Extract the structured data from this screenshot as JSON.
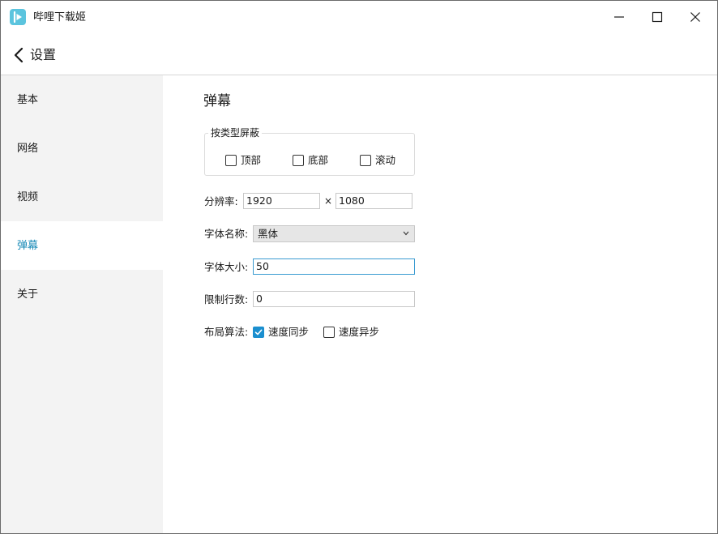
{
  "window": {
    "app_title": "哔哩下载姬",
    "icons": {
      "app": "app-logo-icon",
      "minimize": "minimize-icon",
      "maximize": "maximize-icon",
      "close": "close-icon"
    }
  },
  "header": {
    "back_icon": "chevron-left-icon",
    "title": "设置"
  },
  "sidebar": {
    "items": [
      {
        "label": "基本",
        "active": false
      },
      {
        "label": "网络",
        "active": false
      },
      {
        "label": "视频",
        "active": false
      },
      {
        "label": "弹幕",
        "active": true
      },
      {
        "label": "关于",
        "active": false
      }
    ]
  },
  "content": {
    "section_title": "弹幕",
    "block_by_type": {
      "legend": "按类型屏蔽",
      "options": [
        {
          "label": "顶部",
          "checked": false
        },
        {
          "label": "底部",
          "checked": false
        },
        {
          "label": "滚动",
          "checked": false
        }
      ]
    },
    "resolution": {
      "label": "分辨率:",
      "width": "1920",
      "separator": "×",
      "height": "1080"
    },
    "font_name": {
      "label": "字体名称:",
      "value": "黑体"
    },
    "font_size": {
      "label": "字体大小:",
      "value": "50"
    },
    "line_limit": {
      "label": "限制行数:",
      "value": "0"
    },
    "layout_algorithm": {
      "label": "布局算法:",
      "options": [
        {
          "label": "速度同步",
          "checked": true
        },
        {
          "label": "速度异步",
          "checked": false
        }
      ]
    }
  },
  "colors": {
    "accent": "#1b8fcf",
    "active_nav_text": "#1789b6",
    "sidebar_bg": "#f3f3f3",
    "app_icon": "#5bc4de"
  }
}
